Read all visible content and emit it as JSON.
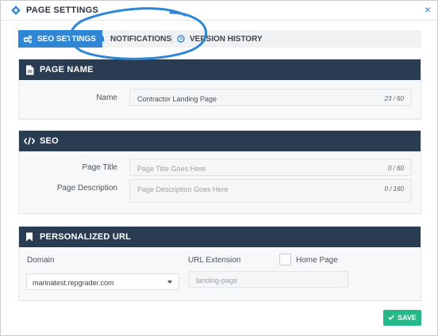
{
  "window": {
    "title": "PAGE SETTINGS",
    "close_glyph": "×"
  },
  "tabs": [
    {
      "label": "SEO SETTINGS",
      "icon": "gears-icon",
      "active": true
    },
    {
      "label": "NOTIFICATIONS",
      "icon": "bell-icon",
      "active": false
    },
    {
      "label": "VERSION HISTORY",
      "icon": "clock-icon",
      "active": false
    }
  ],
  "page_name": {
    "header": "PAGE NAME",
    "icon": "document-icon",
    "name_label": "Name",
    "name_value": "Contractor Landing Page",
    "name_counter": "23 / 60"
  },
  "seo": {
    "header": "SEO",
    "icon": "code-icon",
    "title_label": "Page Title",
    "title_placeholder": "Page Title Goes Here",
    "title_counter": "0 / 60",
    "desc_label": "Page Description",
    "desc_placeholder": "Page Description Goes Here",
    "desc_counter": "0 / 160"
  },
  "personalized_url": {
    "header": "PERSONALIZED URL",
    "icon": "bookmark-icon",
    "domain_label": "Domain",
    "domain_value": "marinatest.repgrader.com",
    "extension_label": "URL Extension",
    "extension_placeholder": "landing-page",
    "home_page_label": "Home Page",
    "home_page_checked": false
  },
  "footer": {
    "save_label": "SAVE"
  },
  "colors": {
    "accent": "#2f86d4",
    "header_bg": "#2a3c51",
    "save": "#25b98a",
    "annotation": "#2f86d4"
  }
}
